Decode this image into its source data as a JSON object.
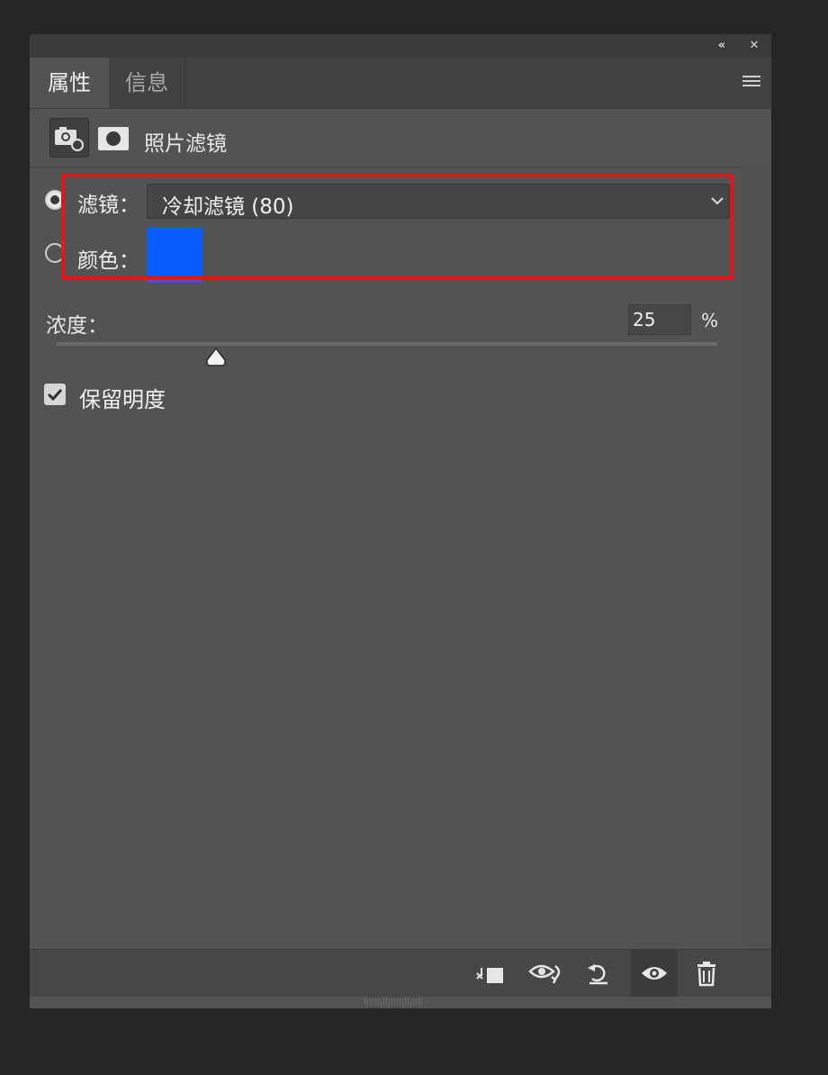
{
  "panel": {
    "title_buttons": {
      "collapse": "«",
      "close": "✕"
    },
    "tabs": [
      {
        "label": "属性",
        "active": true
      },
      {
        "label": "信息",
        "active": false
      }
    ],
    "menu_icon": "hamburger-menu-icon"
  },
  "adjustment": {
    "title": "照片滤镜",
    "icons": [
      "camera-adjustment-icon",
      "layer-mask-icon"
    ]
  },
  "filter": {
    "label": "滤镜：",
    "value": "冷却滤镜 (80)",
    "selected": true
  },
  "color": {
    "label": "颜色：",
    "swatch": "#0a5cff",
    "selected": false
  },
  "density": {
    "label": "浓度：",
    "value": "25",
    "unit": "%",
    "level": 0.25
  },
  "preserve": {
    "label": "保留明度",
    "checked": true
  },
  "highlight_color": "#e01818",
  "bottom_icons": [
    "clip-to-layer-icon",
    "view-previous-state-icon",
    "reset-icon",
    "visibility-icon",
    "trash-icon"
  ]
}
